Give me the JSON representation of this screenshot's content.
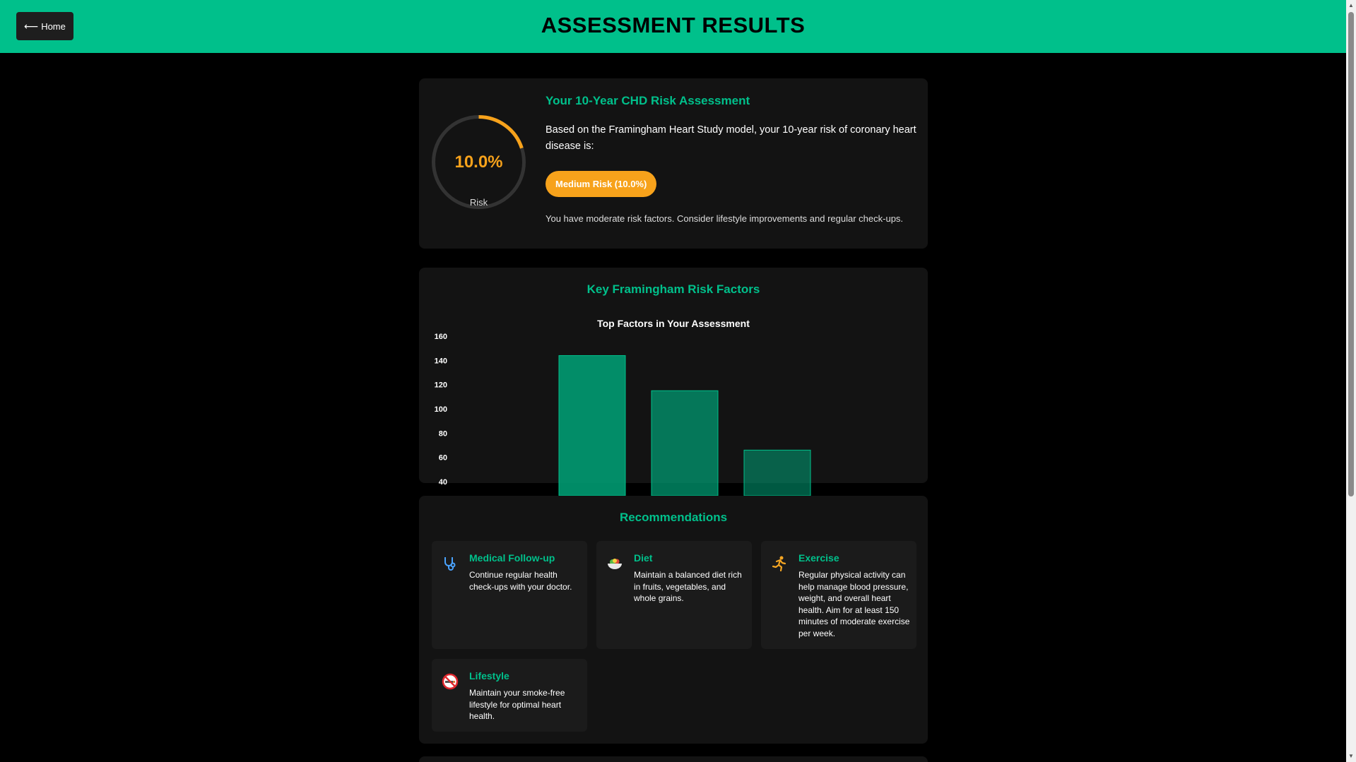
{
  "header": {
    "home_label": "Home",
    "title": "ASSESSMENT RESULTS",
    "accent_color": "#00c08b"
  },
  "risk": {
    "gauge_value": "10.0%",
    "gauge_label": "Risk",
    "percent": 10.0,
    "title": "Your 10-Year CHD Risk Assessment",
    "description": "Based on the Framingham Heart Study model, your 10-year risk of coronary heart disease is:",
    "badge": "Medium Risk (10.0%)",
    "badge_color": "#f7a21b",
    "note": "You have moderate risk factors. Consider lifestyle improvements and regular check-ups."
  },
  "factors": {
    "heading": "Key Framingham Risk Factors"
  },
  "chart_data": {
    "type": "bar",
    "title": "Top Factors in Your Assessment",
    "y_ticks": [
      "160",
      "140",
      "120",
      "100",
      "80",
      "60",
      "40"
    ],
    "ylim": [
      40,
      160
    ],
    "values": [
      144,
      115,
      66
    ],
    "bar_color": "#00a378"
  },
  "recommendations": {
    "heading": "Recommendations",
    "items": [
      {
        "icon": "stethoscope-icon",
        "title": "Medical Follow-up",
        "text": "Continue regular health check-ups with your doctor."
      },
      {
        "icon": "salad-bowl-icon",
        "title": "Diet",
        "text": "Maintain a balanced diet rich in fruits, vegetables, and whole grains."
      },
      {
        "icon": "running-person-icon",
        "title": "Exercise",
        "text": "Regular physical activity can help manage blood pressure, weight, and overall heart health. Aim for at least 150 minutes of moderate exercise per week."
      },
      {
        "icon": "no-smoking-icon",
        "title": "Lifestyle",
        "text": "Maintain your smoke-free lifestyle for optimal heart health."
      }
    ]
  }
}
